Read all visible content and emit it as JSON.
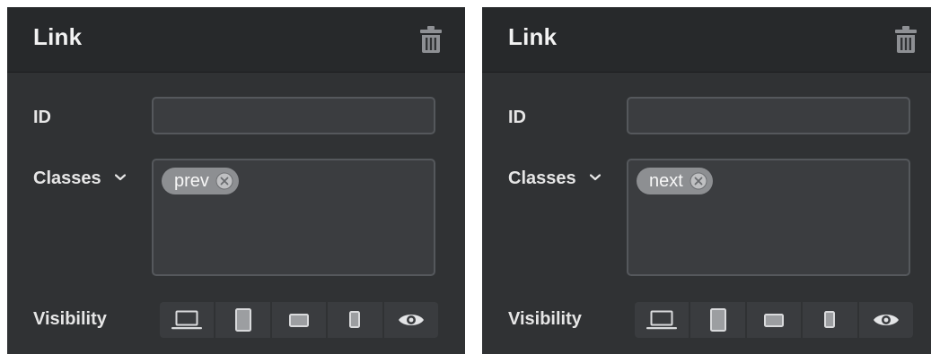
{
  "panels": [
    {
      "title": "Link",
      "trash_icon": "trash-icon",
      "id_label": "ID",
      "id_value": "",
      "classes_label": "Classes",
      "classes_dropdown_icon": "chevron-down-icon",
      "classes": [
        {
          "label": "prev",
          "remove_icon": "remove-circle-icon"
        }
      ],
      "visibility_label": "Visibility",
      "visibility_options": [
        {
          "icon": "laptop-icon"
        },
        {
          "icon": "tablet-portrait-icon"
        },
        {
          "icon": "tablet-landscape-icon"
        },
        {
          "icon": "phone-icon"
        },
        {
          "icon": "eye-icon"
        }
      ]
    },
    {
      "title": "Link",
      "trash_icon": "trash-icon",
      "id_label": "ID",
      "id_value": "",
      "classes_label": "Classes",
      "classes_dropdown_icon": "chevron-down-icon",
      "classes": [
        {
          "label": "next",
          "remove_icon": "remove-circle-icon"
        }
      ],
      "visibility_label": "Visibility",
      "visibility_options": [
        {
          "icon": "laptop-icon"
        },
        {
          "icon": "tablet-portrait-icon"
        },
        {
          "icon": "tablet-landscape-icon"
        },
        {
          "icon": "phone-icon"
        },
        {
          "icon": "eye-icon"
        }
      ]
    }
  ],
  "colors": {
    "panel_bg": "#303234",
    "header_bg": "#27292b",
    "field_bg": "#3b3d40",
    "field_border": "#55585c",
    "chip_bg": "#8d8f92",
    "text": "#f2f2f2",
    "icon": "#cfd0d2"
  }
}
